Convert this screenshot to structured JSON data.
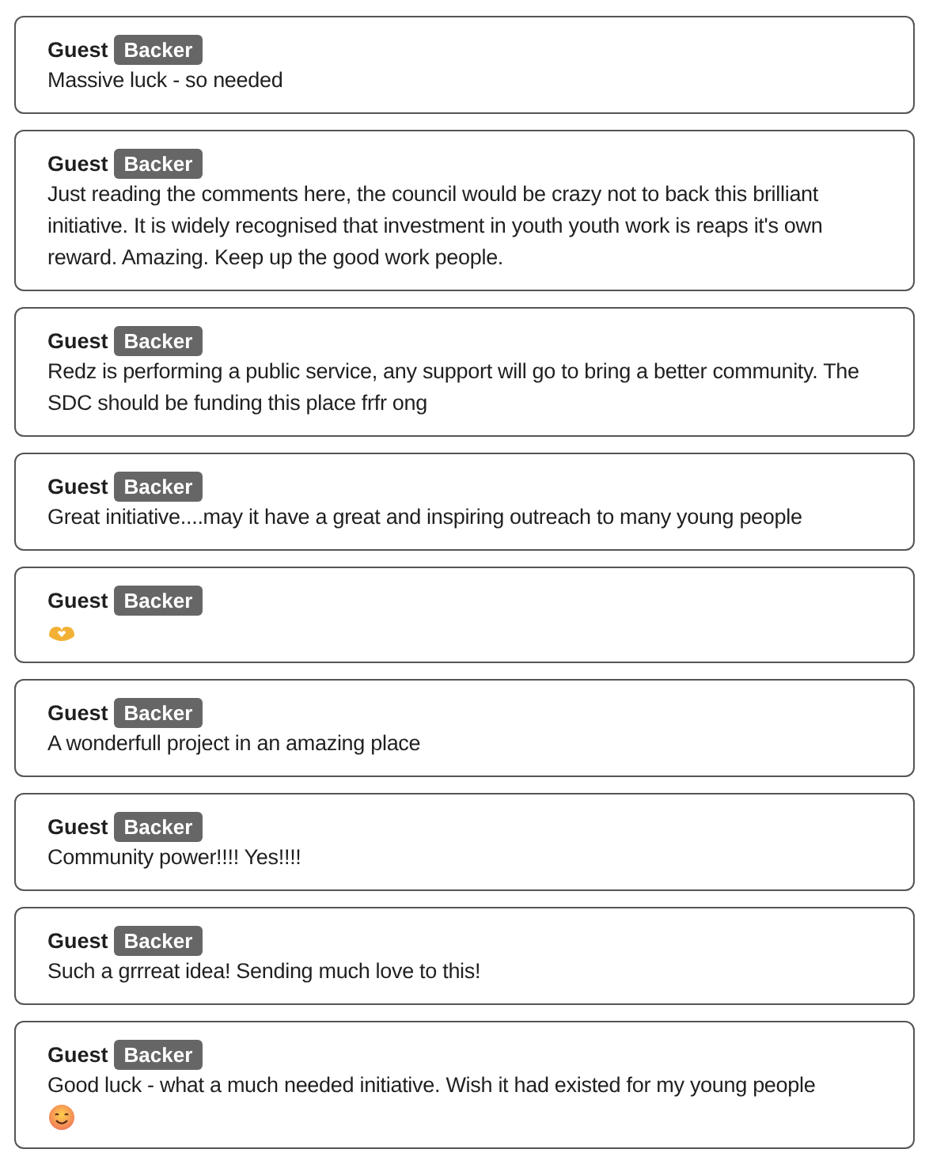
{
  "comments": [
    {
      "kind": "text",
      "author": "Guest",
      "badge": "Backer",
      "message": "Massive luck - so needed"
    },
    {
      "kind": "text",
      "author": "Guest",
      "badge": "Backer",
      "message": "Just reading the comments here, the council would be crazy not to back this brilliant initiative. It is widely recognised that investment in youth youth work is reaps it's own reward. Amazing. Keep up the good work people."
    },
    {
      "kind": "text",
      "author": "Guest",
      "badge": "Backer",
      "message": "Redz is performing a public service, any support will go to bring a better community. The SDC should be funding this place frfr ong"
    },
    {
      "kind": "text",
      "author": "Guest",
      "badge": "Backer",
      "message": "Great initiative....may it have a great and inspiring outreach to many young people"
    },
    {
      "kind": "heart",
      "author": "Guest",
      "badge": "Backer"
    },
    {
      "kind": "text",
      "author": "Guest",
      "badge": "Backer",
      "message": "A wonderfull project in an amazing place"
    },
    {
      "kind": "text",
      "author": "Guest",
      "badge": "Backer",
      "message": "Community power!!!! Yes!!!!"
    },
    {
      "kind": "text",
      "author": "Guest",
      "badge": "Backer",
      "message": "Such a grrreat idea! Sending much love to this!"
    },
    {
      "kind": "smile",
      "author": "Guest",
      "badge": "Backer",
      "message": "Good luck - what a much needed initiative. Wish it had existed for my young people"
    }
  ]
}
